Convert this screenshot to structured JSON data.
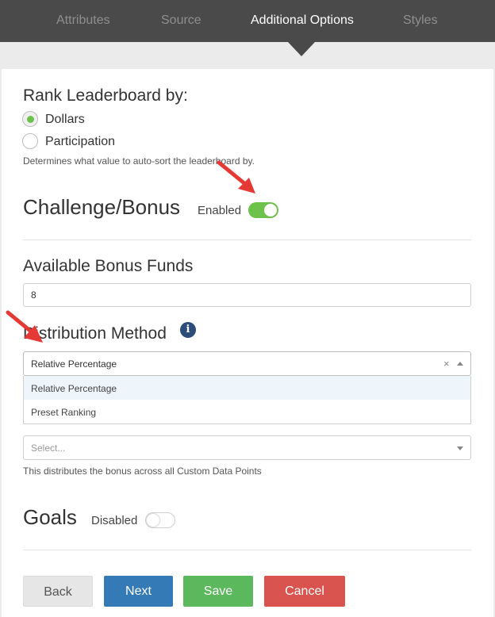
{
  "tabs": [
    {
      "label": "Attributes",
      "active": false
    },
    {
      "label": "Source",
      "active": false
    },
    {
      "label": "Additional Options",
      "active": true
    },
    {
      "label": "Styles",
      "active": false
    }
  ],
  "rank": {
    "title": "Rank Leaderboard by:",
    "options": [
      {
        "label": "Dollars",
        "checked": true
      },
      {
        "label": "Participation",
        "checked": false
      }
    ],
    "help": "Determines what value to auto-sort the leaderboard by."
  },
  "challenge": {
    "title": "Challenge/Bonus",
    "toggle_label": "Enabled",
    "enabled": true
  },
  "bonus_funds": {
    "label": "Available Bonus Funds",
    "value": "8"
  },
  "distribution": {
    "label": "Distribution Method",
    "info_glyph": "i",
    "selected": "Relative Percentage",
    "clear_glyph": "×",
    "options": [
      "Relative Percentage",
      "Preset Ranking"
    ]
  },
  "distribute_based": {
    "placeholder": "Select...",
    "help": "This distributes the bonus across all Custom Data Points"
  },
  "goals": {
    "title": "Goals",
    "toggle_label": "Disabled",
    "enabled": false
  },
  "buttons": {
    "back": "Back",
    "next": "Next",
    "save": "Save",
    "cancel": "Cancel"
  },
  "colors": {
    "nav_bg": "#4a4a4a",
    "accent_green": "#6cc24a",
    "next_blue": "#337ab7",
    "save_green": "#5cb85c",
    "cancel_red": "#d9534f",
    "back_gray": "#e6e6e6",
    "annotation_red": "#e53935"
  }
}
